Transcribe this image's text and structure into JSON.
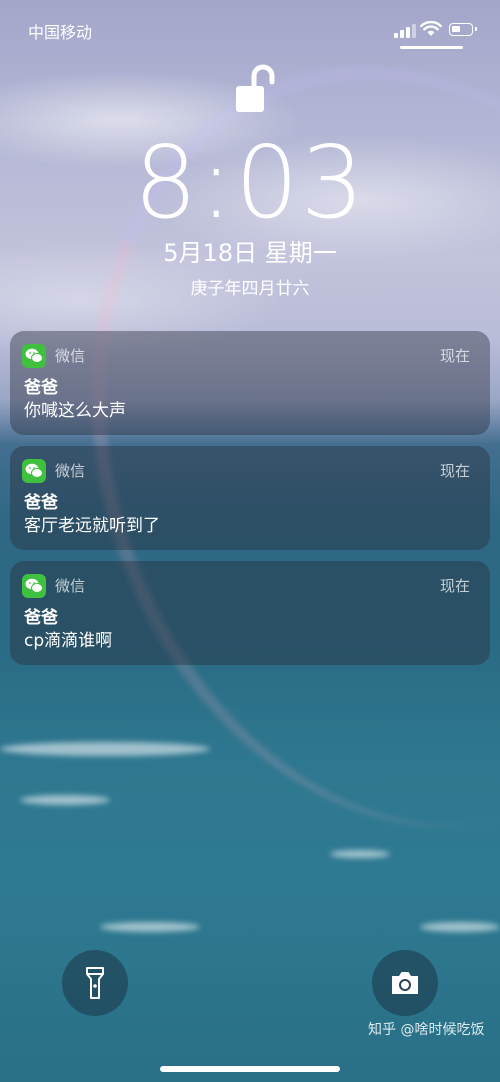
{
  "status_bar": {
    "carrier": "中国移动",
    "icons": [
      "signal-icon",
      "wifi-icon",
      "battery-icon"
    ],
    "battery_level": 0.4
  },
  "lock_screen": {
    "lock_icon": "unlocked-padlock-icon",
    "time": "8:03",
    "date": "5月18日 星期一",
    "lunar_date": "庚子年四月廿六"
  },
  "notifications": [
    {
      "app": "微信",
      "time": "现在",
      "sender": "爸爸",
      "message": "你喊这么大声"
    },
    {
      "app": "微信",
      "time": "现在",
      "sender": "爸爸",
      "message": "客厅老远就听到了"
    },
    {
      "app": "微信",
      "time": "现在",
      "sender": "爸爸",
      "message": "cp滴滴谁啊"
    }
  ],
  "bottom_controls": {
    "left": "flashlight-icon",
    "right": "camera-icon"
  },
  "watermark": "知乎 @啥时候吃饭",
  "colors": {
    "wechat_green": "#3fc13f",
    "text": "#ffffff"
  }
}
